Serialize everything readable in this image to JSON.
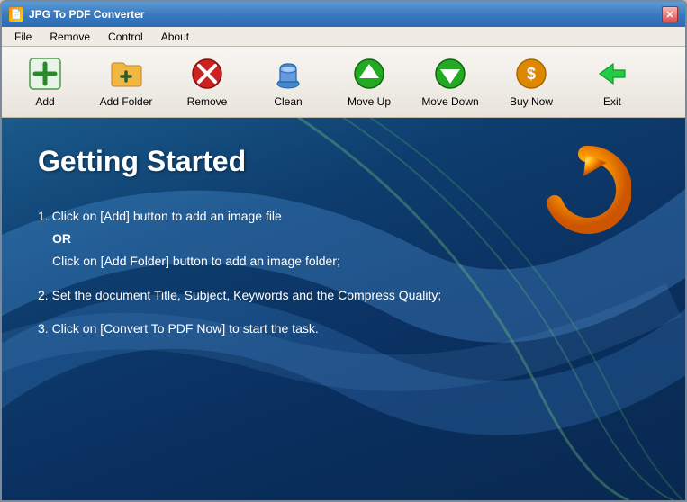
{
  "window": {
    "title": "JPG To PDF Converter",
    "close_label": "✕"
  },
  "menu": {
    "items": [
      {
        "label": "File"
      },
      {
        "label": "Remove"
      },
      {
        "label": "Control"
      },
      {
        "label": "About"
      }
    ]
  },
  "toolbar": {
    "buttons": [
      {
        "id": "add",
        "label": "Add"
      },
      {
        "id": "add-folder",
        "label": "Add Folder"
      },
      {
        "id": "remove",
        "label": "Remove"
      },
      {
        "id": "clean",
        "label": "Clean"
      },
      {
        "id": "move-up",
        "label": "Move Up"
      },
      {
        "id": "move-down",
        "label": "Move Down"
      },
      {
        "id": "buy-now",
        "label": "Buy Now"
      },
      {
        "id": "exit",
        "label": "Exit"
      }
    ]
  },
  "main": {
    "title": "Getting Started",
    "instructions": [
      {
        "number": "1.",
        "text": "Click on [Add] button to add an image file",
        "or": "OR",
        "sub": "Click on [Add Folder] button to add an image folder;"
      },
      {
        "number": "2.",
        "text": "Set the document Title, Subject, Keywords and the Compress Quality;"
      },
      {
        "number": "3.",
        "text": "Click on [Convert To PDF Now] to start the task."
      }
    ]
  }
}
